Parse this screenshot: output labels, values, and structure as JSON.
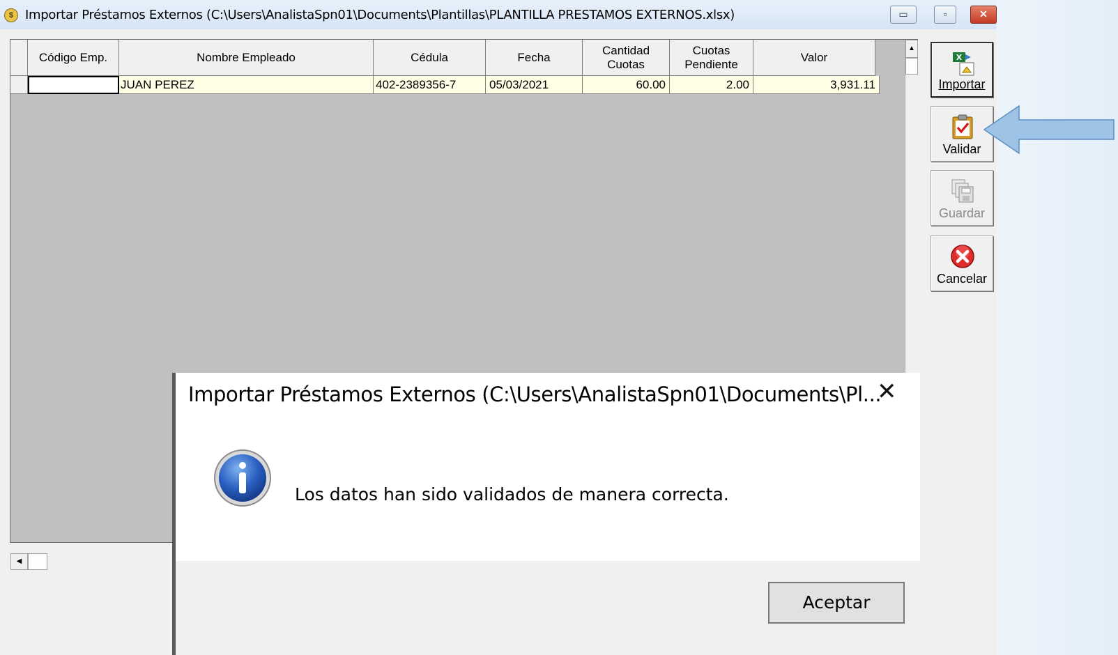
{
  "window": {
    "title": "Importar Préstamos Externos (C:\\Users\\AnalistaSpn01\\Documents\\Plantillas\\PLANTILLA PRESTAMOS EXTERNOS.xlsx)",
    "min_glyph": "▭",
    "max_glyph": "▫",
    "close_glyph": "✕"
  },
  "grid": {
    "columns": [
      {
        "label": "Código Emp."
      },
      {
        "label": "Nombre Empleado"
      },
      {
        "label": "Cédula"
      },
      {
        "label": "Fecha"
      },
      {
        "label": "Cantidad Cuotas"
      },
      {
        "label": "Cuotas Pendiente"
      },
      {
        "label": "Valor"
      }
    ],
    "rows": [
      {
        "codigo": "",
        "nombre": "JUAN PEREZ",
        "cedula": "402-2389356-7",
        "fecha": "05/03/2021",
        "cantidad": "60.00",
        "pendiente": "2.00",
        "valor": "3,931.11"
      }
    ]
  },
  "toolbar": {
    "importar": "Importar",
    "validar": "Validar",
    "guardar": "Guardar",
    "cancelar": "Cancelar"
  },
  "dialog": {
    "title": "Importar Préstamos Externos (C:\\Users\\AnalistaSpn01\\Documents\\Pl...",
    "message": "Los datos han sido validados de manera correcta.",
    "ok_label": "Aceptar",
    "close_glyph": "✕"
  },
  "colors": {
    "row_bg": "#ffffe6",
    "grid_bg": "#c0c0c0",
    "arrow": "#9dc3e6"
  }
}
